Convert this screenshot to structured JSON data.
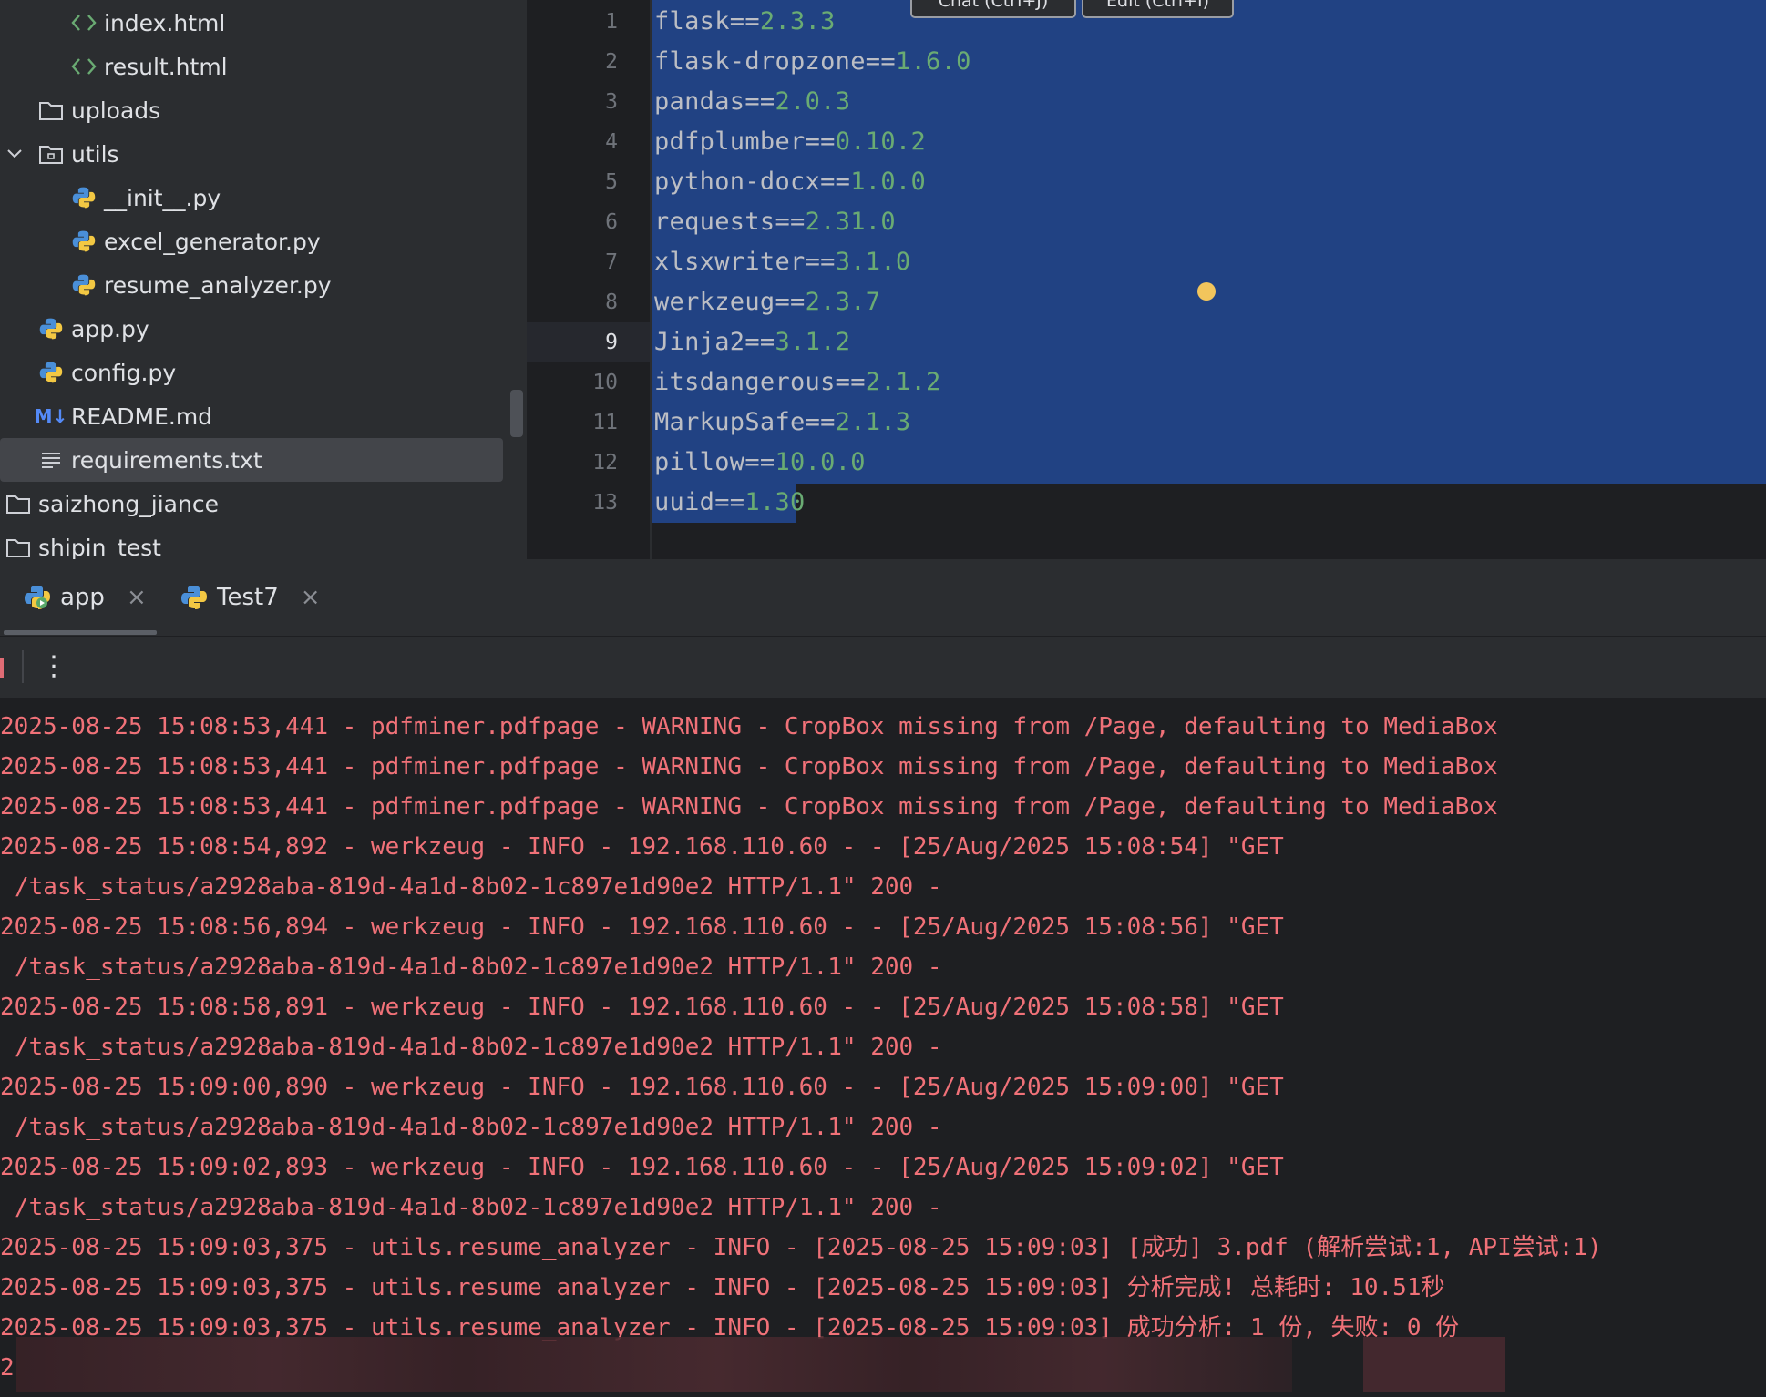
{
  "project_tree": {
    "items": [
      {
        "label": "index.html",
        "icon": "html-icon"
      },
      {
        "label": "result.html",
        "icon": "html-icon"
      },
      {
        "label": "uploads",
        "icon": "folder-icon"
      },
      {
        "label": "utils",
        "icon": "package-folder-icon"
      },
      {
        "label": "__init__.py",
        "icon": "python-icon"
      },
      {
        "label": "excel_generator.py",
        "icon": "python-icon"
      },
      {
        "label": "resume_analyzer.py",
        "icon": "python-icon"
      },
      {
        "label": "app.py",
        "icon": "python-icon"
      },
      {
        "label": "config.py",
        "icon": "python-icon"
      },
      {
        "label": "README.md",
        "icon": "markdown-icon"
      },
      {
        "label": "requirements.txt",
        "icon": "text-file-icon"
      },
      {
        "label": "saizhong_jiance",
        "icon": "folder-icon"
      },
      {
        "label": "shipin_test",
        "icon": "folder-icon"
      }
    ],
    "markdown_badge": "M↓"
  },
  "editor": {
    "buttons": {
      "chat": "Chat (Ctrl+J)",
      "edit": "Edit (Ctrl+I)"
    },
    "current_line": 9,
    "lines": [
      {
        "num": "1",
        "pkg": "flask",
        "op": "==",
        "ver": "2.3.3"
      },
      {
        "num": "2",
        "pkg": "flask-dropzone",
        "op": "==",
        "ver": "1.6.0"
      },
      {
        "num": "3",
        "pkg": "pandas",
        "op": "==",
        "ver": "2.0.3"
      },
      {
        "num": "4",
        "pkg": "pdfplumber",
        "op": "==",
        "ver": "0.10.2"
      },
      {
        "num": "5",
        "pkg": "python-docx",
        "op": "==",
        "ver": "1.0.0"
      },
      {
        "num": "6",
        "pkg": "requests",
        "op": "==",
        "ver": "2.31.0"
      },
      {
        "num": "7",
        "pkg": "xlsxwriter",
        "op": "==",
        "ver": "3.1.0"
      },
      {
        "num": "8",
        "pkg": "werkzeug",
        "op": "==",
        "ver": "2.3.7"
      },
      {
        "num": "9",
        "pkg": "Jinja2",
        "op": "==",
        "ver": "3.1.2"
      },
      {
        "num": "10",
        "pkg": "itsdangerous",
        "op": "==",
        "ver": "2.1.2"
      },
      {
        "num": "11",
        "pkg": "MarkupSafe",
        "op": "==",
        "ver": "2.1.3"
      },
      {
        "num": "12",
        "pkg": "pillow",
        "op": "==",
        "ver": "10.0.0"
      },
      {
        "num": "13",
        "pkg": "uuid",
        "op": "==",
        "ver": "1.30"
      }
    ]
  },
  "run_panel": {
    "tabs": [
      {
        "label": "app",
        "icon": "python-run-icon",
        "active": true
      },
      {
        "label": "Test7",
        "icon": "python-run-icon",
        "active": false
      }
    ],
    "close_glyph": "×",
    "kebab_glyph": "⋮",
    "console_lines": [
      {
        "text": "2025-08-25 15:08:53,441 - pdfminer.pdfpage - WARNING - CropBox missing from /Page, defaulting to MediaBox",
        "cont": false
      },
      {
        "text": "2025-08-25 15:08:53,441 - pdfminer.pdfpage - WARNING - CropBox missing from /Page, defaulting to MediaBox",
        "cont": false
      },
      {
        "text": "2025-08-25 15:08:53,441 - pdfminer.pdfpage - WARNING - CropBox missing from /Page, defaulting to MediaBox",
        "cont": false
      },
      {
        "text": "2025-08-25 15:08:54,892 - werkzeug - INFO - 192.168.110.60 - - [25/Aug/2025 15:08:54] \"GET",
        "cont": false
      },
      {
        "text": "/task_status/a2928aba-819d-4a1d-8b02-1c897e1d90e2 HTTP/1.1\" 200 -",
        "cont": true
      },
      {
        "text": "2025-08-25 15:08:56,894 - werkzeug - INFO - 192.168.110.60 - - [25/Aug/2025 15:08:56] \"GET",
        "cont": false
      },
      {
        "text": "/task_status/a2928aba-819d-4a1d-8b02-1c897e1d90e2 HTTP/1.1\" 200 -",
        "cont": true
      },
      {
        "text": "2025-08-25 15:08:58,891 - werkzeug - INFO - 192.168.110.60 - - [25/Aug/2025 15:08:58] \"GET",
        "cont": false
      },
      {
        "text": "/task_status/a2928aba-819d-4a1d-8b02-1c897e1d90e2 HTTP/1.1\" 200 -",
        "cont": true
      },
      {
        "text": "2025-08-25 15:09:00,890 - werkzeug - INFO - 192.168.110.60 - - [25/Aug/2025 15:09:00] \"GET",
        "cont": false
      },
      {
        "text": "/task_status/a2928aba-819d-4a1d-8b02-1c897e1d90e2 HTTP/1.1\" 200 -",
        "cont": true
      },
      {
        "text": "2025-08-25 15:09:02,893 - werkzeug - INFO - 192.168.110.60 - - [25/Aug/2025 15:09:02] \"GET",
        "cont": false
      },
      {
        "text": "/task_status/a2928aba-819d-4a1d-8b02-1c897e1d90e2 HTTP/1.1\" 200 -",
        "cont": true
      },
      {
        "text": "2025-08-25 15:09:03,375 - utils.resume_analyzer - INFO - [2025-08-25 15:09:03] [成功] 3.pdf (解析尝试:1, API尝试:1)",
        "cont": false
      },
      {
        "text": "2025-08-25 15:09:03,375 - utils.resume_analyzer - INFO - [2025-08-25 15:09:03] 分析完成! 总耗时: 10.51秒",
        "cont": false
      },
      {
        "text": "2025-08-25 15:09:03,375 - utils.resume_analyzer - INFO - [2025-08-25 15:09:03] 成功分析: 1 份, 失败: 0 份",
        "cont": false
      },
      {
        "text": "2",
        "cont": false
      }
    ]
  },
  "colors": {
    "tree_bg": "#2b2d30",
    "editor_bg": "#1e1f22",
    "selection": "#214283",
    "version_green": "#6aab73",
    "log_red": "#f07178"
  }
}
